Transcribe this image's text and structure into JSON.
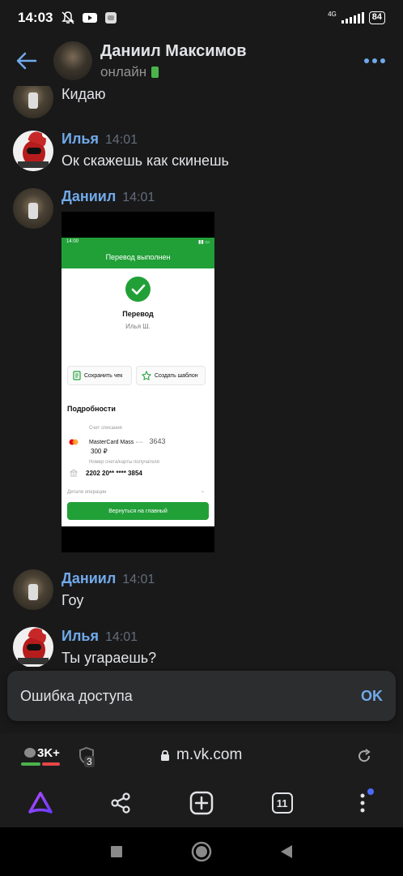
{
  "status_bar": {
    "time": "14:03",
    "network": "4G",
    "battery": "84",
    "icons": [
      "bell-off-icon",
      "youtube-icon",
      "chat-app-icon"
    ]
  },
  "header": {
    "name": "Даниил Максимов",
    "status": "онлайн",
    "back_icon": "arrow-left-icon",
    "more_icon": "more-dots-icon"
  },
  "messages": [
    {
      "author": "",
      "time": "",
      "text": "Кидаю"
    },
    {
      "author": "Илья",
      "time": "14:01",
      "text": "Ок скажешь как скинешь"
    },
    {
      "author": "Даниил",
      "time": "14:01",
      "text": ""
    },
    {
      "author": "Даниил",
      "time": "14:01",
      "text": "Гоу"
    },
    {
      "author": "Илья",
      "time": "14:01",
      "text": "Ты угараешь?"
    }
  ],
  "attachment": {
    "status_time": "14:00",
    "title": "Перевод выполнен",
    "heading": "Перевод",
    "recipient": "Илья Ш.",
    "save_receipt": "Сохранить чек",
    "create_template": "Создать шаблон",
    "details_heading": "Подробности",
    "debit_label": "Счет списания",
    "card_name": "MasterCard Mass ····",
    "card_last": "3643",
    "amount": "300 ₽",
    "recipient_label": "Номер счета/карты получателя",
    "recipient_card": "2202 20** **** 3854",
    "operation_details": "Детали операции",
    "return_button": "Вернуться на главный"
  },
  "snackbar": {
    "text": "Ошибка доступа",
    "action": "OK"
  },
  "browser": {
    "chat_count": "3K+",
    "shield_count": "3",
    "url": "m.vk.com",
    "tabs_count": "11"
  },
  "colors": {
    "background": "#19191a",
    "accent": "#71aaeb",
    "author": "#71aaeb",
    "sber_green": "#21a038",
    "online_green": "#4bb34b"
  }
}
